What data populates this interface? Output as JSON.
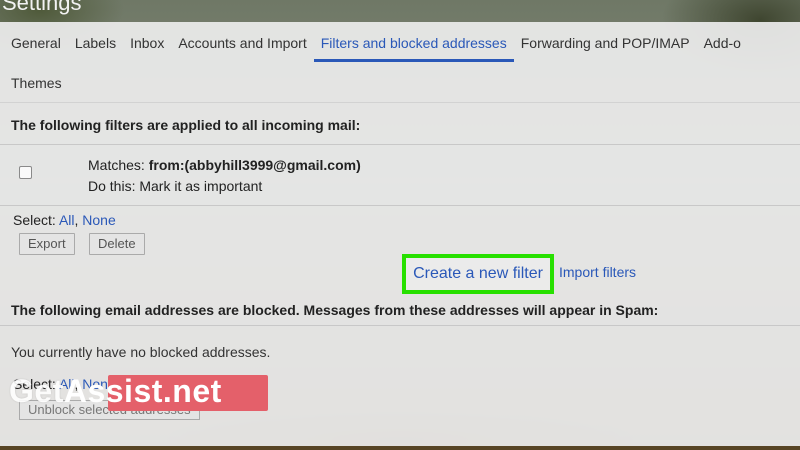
{
  "window": {
    "title": "Settings"
  },
  "tabs_row1": [
    {
      "label": "General",
      "active": false
    },
    {
      "label": "Labels",
      "active": false
    },
    {
      "label": "Inbox",
      "active": false
    },
    {
      "label": "Accounts and Import",
      "active": false
    },
    {
      "label": "Filters and blocked addresses",
      "active": true
    },
    {
      "label": "Forwarding and POP/IMAP",
      "active": false
    },
    {
      "label": "Add-o",
      "active": false
    }
  ],
  "tabs_row2": [
    {
      "label": "Themes",
      "active": false
    }
  ],
  "filters_section": {
    "heading": "The following filters are applied to all incoming mail:",
    "filter": {
      "matches_label": "Matches:",
      "matches_value": "from:(abbyhill3999@gmail.com)",
      "action_label": "Do this:",
      "action_value": "Mark it as important"
    },
    "select_label": "Select:",
    "select_all": "All",
    "select_comma": ",",
    "select_none": "None",
    "export_label": "Export",
    "delete_label": "Delete",
    "create_filter_label": "Create a new filter",
    "import_filters_label": "Import filters"
  },
  "blocked_section": {
    "heading": "The following email addresses are blocked. Messages from these addresses will appear in Spam:",
    "empty_text": "You currently have no blocked addresses.",
    "select_label": "Select:",
    "select_all": "All",
    "select_comma": ",",
    "select_none": "None",
    "unblock_label": "Unblock selected addresses"
  },
  "watermark": {
    "part1": "Get",
    "part2": "Assist.net"
  },
  "colors": {
    "accent": "#2a58b8",
    "highlight": "#27e000",
    "watermark_bg": "#e4606a"
  }
}
